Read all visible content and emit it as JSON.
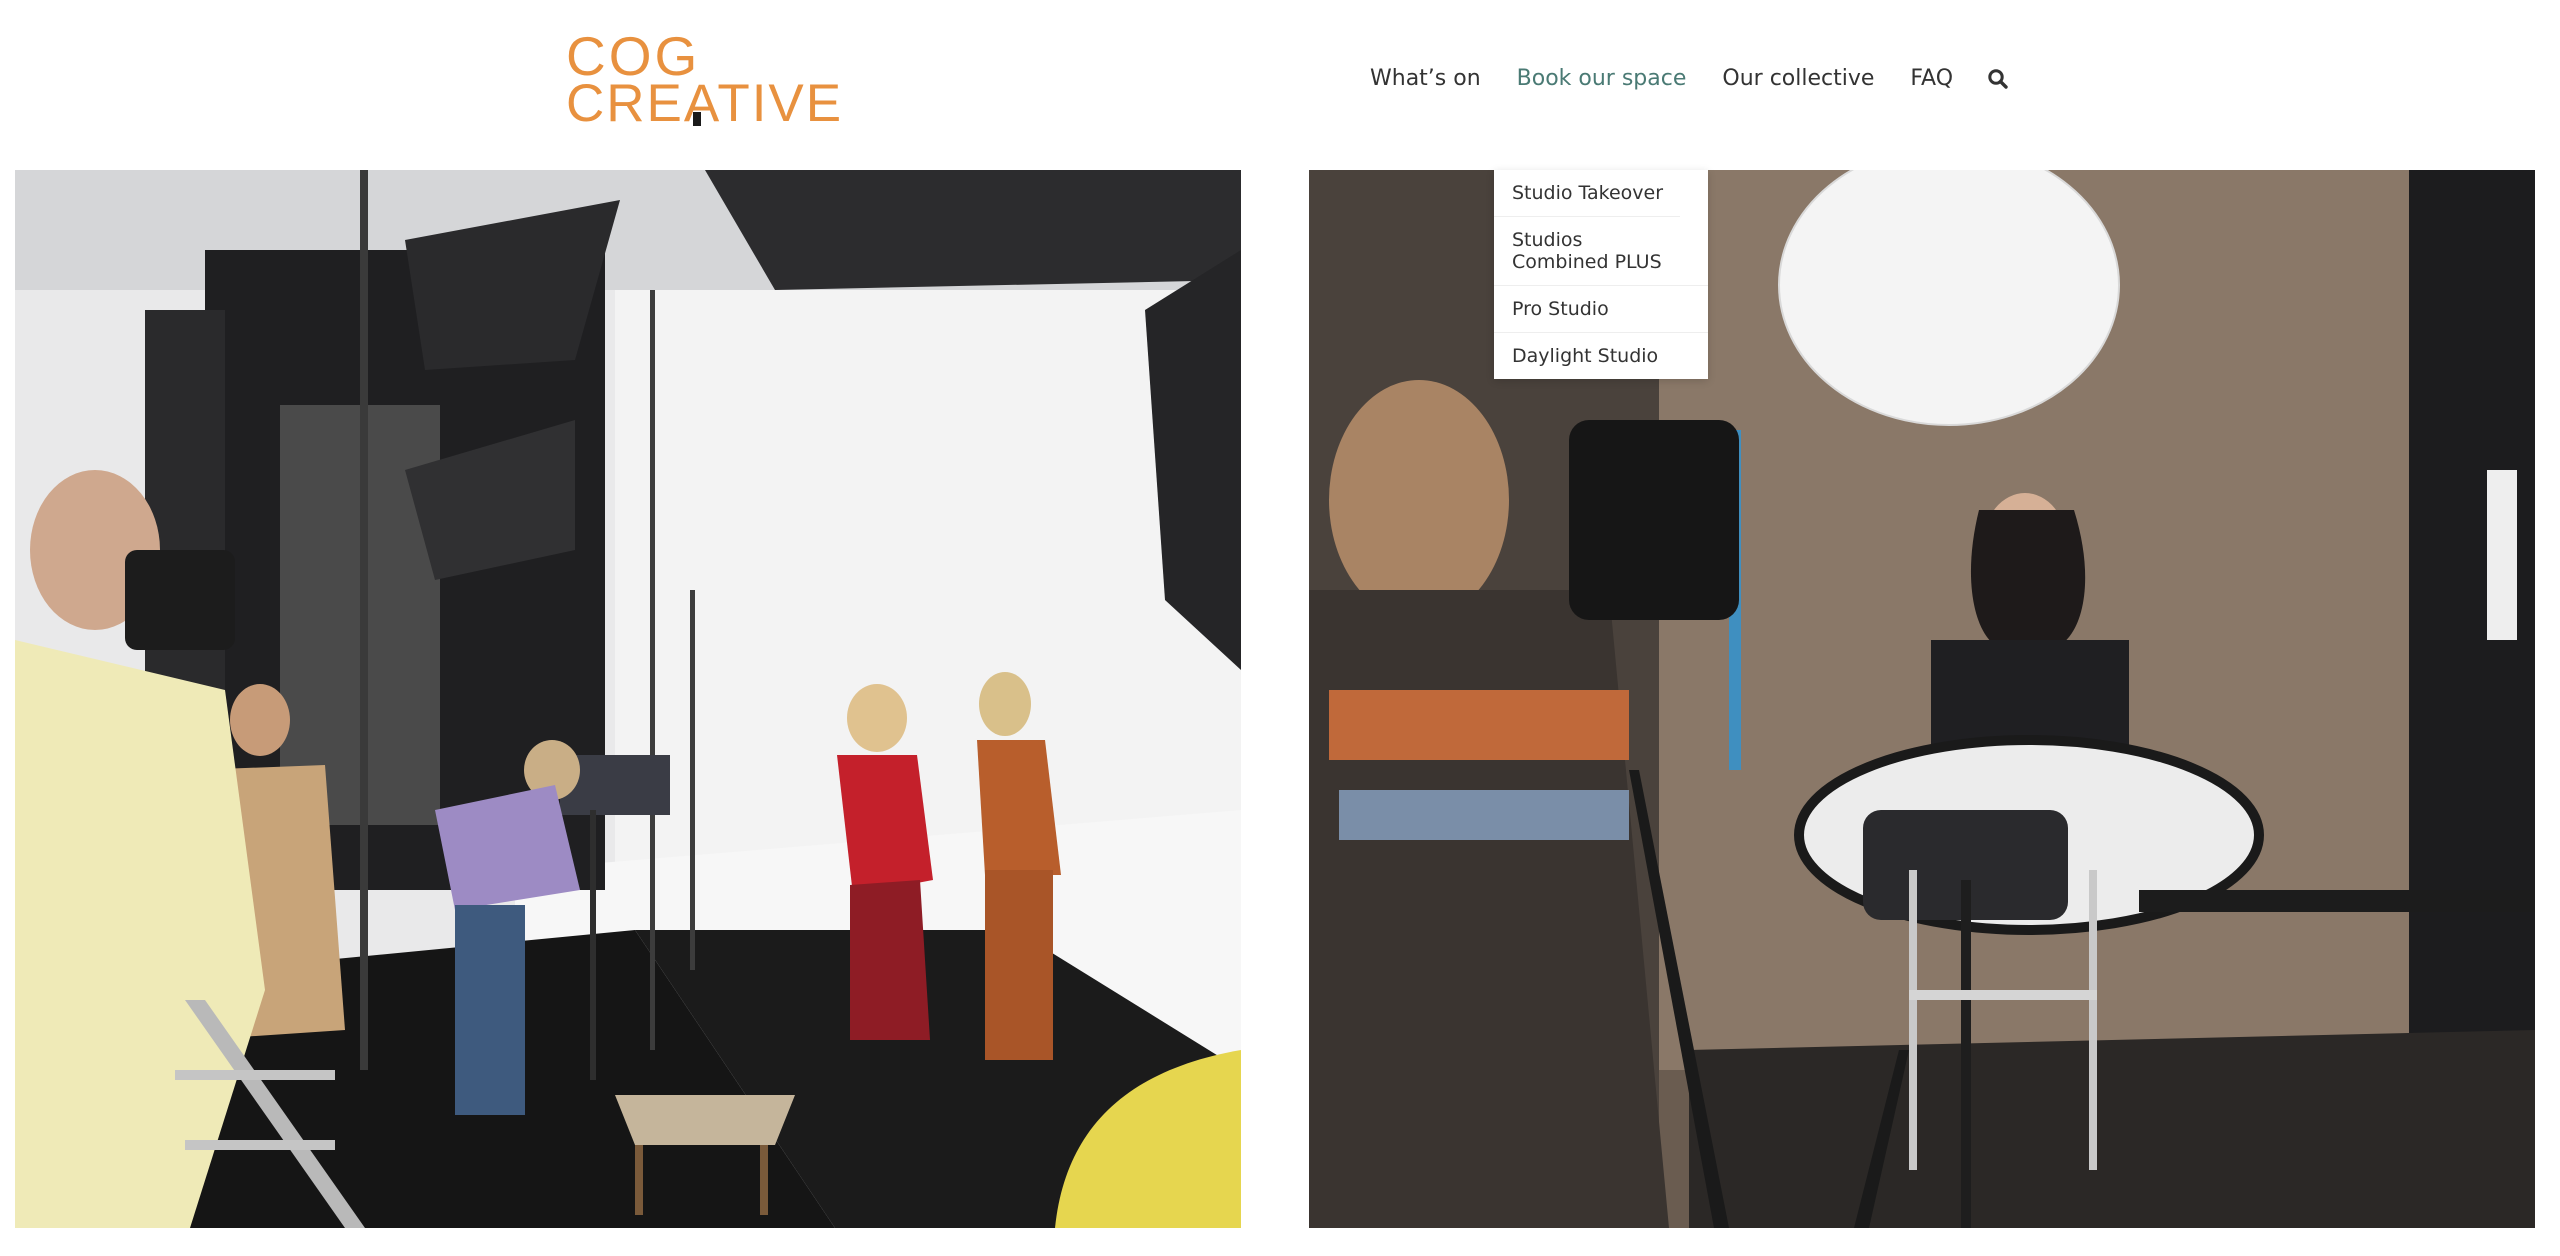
{
  "brand": {
    "logo_line1": "COG",
    "logo_line2": "CREATIVE",
    "accent_color": "#e8913f"
  },
  "nav": {
    "items": [
      {
        "label": "What’s on",
        "active": false
      },
      {
        "label": "Book our space",
        "active": true
      },
      {
        "label": "Our collective",
        "active": false
      },
      {
        "label": "FAQ",
        "active": false
      }
    ],
    "search_icon": "search-icon",
    "active_color": "#4a7a74"
  },
  "dropdown": {
    "items": [
      {
        "label": "Studio Takeover"
      },
      {
        "label": "Studios Combined PLUS"
      },
      {
        "label": "Pro Studio"
      },
      {
        "label": "Daylight Studio"
      }
    ]
  }
}
